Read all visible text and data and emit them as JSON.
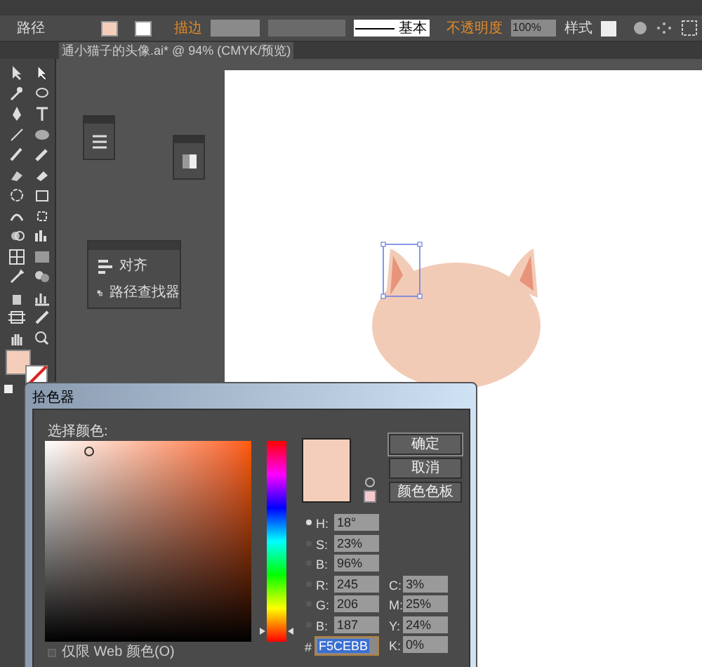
{
  "control_bar": {
    "selection_label": "路径",
    "stroke_label": "描边",
    "brush_profile": "基本",
    "opacity_label": "不透明度",
    "opacity_value": "100%",
    "style_label": "样式"
  },
  "document_tab": {
    "title": "通小猫子的头像.ai* @ 94% (CMYK/预览)"
  },
  "panels": [
    {
      "items": [
        {
          "label": "对齐"
        },
        {
          "label": "路径查找器"
        }
      ]
    }
  ],
  "color_picker": {
    "title": "拾色器",
    "prompt": "选择颜色:",
    "buttons": [
      "确定",
      "取消",
      "颜色色板"
    ],
    "fields": [
      {
        "label": "H:",
        "value": "18°",
        "selected": true
      },
      {
        "label": "S:",
        "value": "23%",
        "selected": false
      },
      {
        "label": "B:",
        "value": "96%",
        "selected": false
      },
      {
        "label": "R:",
        "value": "245",
        "selected": false
      },
      {
        "label": "G:",
        "value": "206",
        "selected": false
      },
      {
        "label": "B:",
        "value": "187",
        "selected": false
      }
    ],
    "cmyk_fields": [
      {
        "label": "C:",
        "value": "3%"
      },
      {
        "label": "M:",
        "value": "25%"
      },
      {
        "label": "Y:",
        "value": "24%"
      },
      {
        "label": "K:",
        "value": "0%"
      }
    ],
    "hue_slider": {
      "level": 0.05
    },
    "hex": {
      "label": "#",
      "value": "F5CEBB"
    },
    "web_only": {
      "label": "仅限 Web 颜色(O)",
      "checked": false
    }
  }
}
